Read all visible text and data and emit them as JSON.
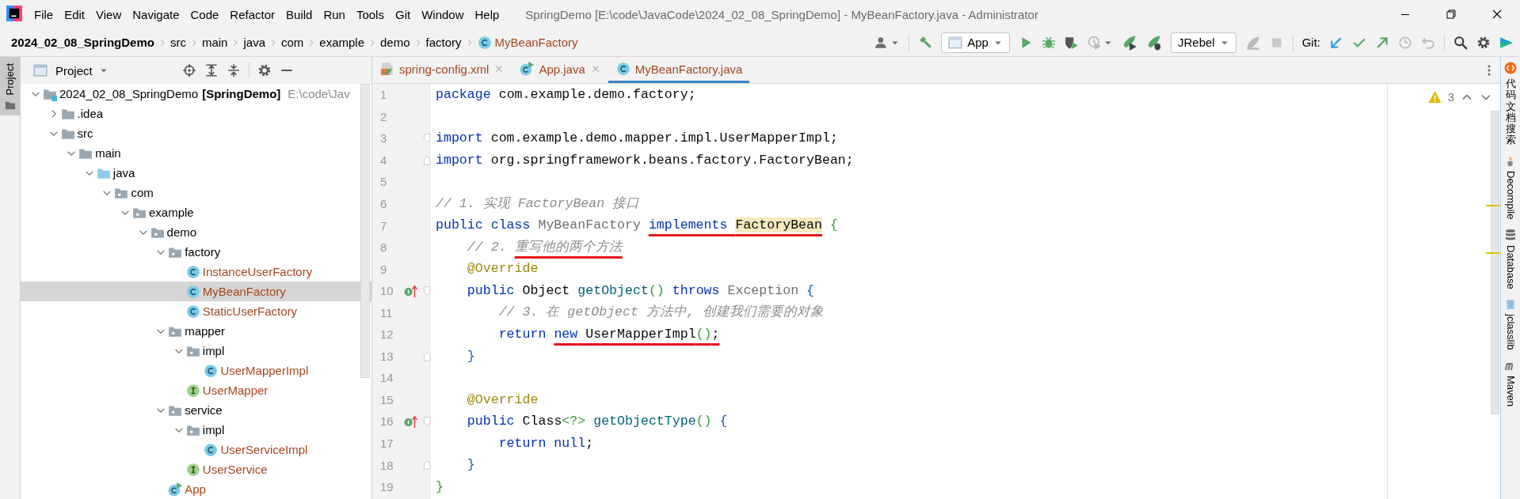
{
  "window": {
    "title": "SpringDemo [E:\\code\\JavaCode\\2024_02_08_SpringDemo] - MyBeanFactory.java - Administrator"
  },
  "menu": [
    {
      "label": "File"
    },
    {
      "label": "Edit"
    },
    {
      "label": "View"
    },
    {
      "label": "Navigate"
    },
    {
      "label": "Code"
    },
    {
      "label": "Refactor"
    },
    {
      "label": "Build"
    },
    {
      "label": "Run"
    },
    {
      "label": "Tools"
    },
    {
      "label": "Git"
    },
    {
      "label": "Window"
    },
    {
      "label": "Help"
    }
  ],
  "breadcrumbs": [
    {
      "label": "2024_02_08_SpringDemo",
      "kind": "project"
    },
    {
      "label": "src",
      "kind": "folder"
    },
    {
      "label": "main",
      "kind": "folder"
    },
    {
      "label": "java",
      "kind": "folder"
    },
    {
      "label": "com",
      "kind": "folder"
    },
    {
      "label": "example",
      "kind": "folder"
    },
    {
      "label": "demo",
      "kind": "folder"
    },
    {
      "label": "factory",
      "kind": "folder"
    },
    {
      "label": "MyBeanFactory",
      "kind": "class"
    }
  ],
  "toolbar": {
    "run_config": "App",
    "jrebel_config": "JRebel",
    "git_label": "Git:"
  },
  "left_stripe": [
    {
      "label": "Project",
      "selected": true
    }
  ],
  "project": {
    "title": "Project",
    "tree": [
      {
        "label": "2024_02_08_SpringDemo",
        "module": "[SpringDemo]",
        "path": "E:\\code\\Jav",
        "kind": "module",
        "expanded": true,
        "selected": false,
        "children": [
          {
            "label": ".idea",
            "kind": "folder",
            "expanded": false,
            "selected": false
          },
          {
            "label": "src",
            "kind": "folder",
            "expanded": true,
            "selected": false,
            "children": [
              {
                "label": "main",
                "kind": "folder",
                "expanded": true,
                "selected": false,
                "children": [
                  {
                    "label": "java",
                    "kind": "source",
                    "expanded": true,
                    "selected": false,
                    "children": [
                      {
                        "label": "com",
                        "kind": "package",
                        "expanded": true,
                        "selected": false,
                        "children": [
                          {
                            "label": "example",
                            "kind": "package",
                            "expanded": true,
                            "selected": false,
                            "children": [
                              {
                                "label": "demo",
                                "kind": "package",
                                "expanded": true,
                                "selected": false,
                                "children": [
                                  {
                                    "label": "factory",
                                    "kind": "package",
                                    "expanded": true,
                                    "selected": false,
                                    "children": [
                                      {
                                        "label": "InstanceUserFactory",
                                        "kind": "class",
                                        "selected": false
                                      },
                                      {
                                        "label": "MyBeanFactory",
                                        "kind": "class",
                                        "selected": true
                                      },
                                      {
                                        "label": "StaticUserFactory",
                                        "kind": "class",
                                        "selected": false
                                      }
                                    ]
                                  },
                                  {
                                    "label": "mapper",
                                    "kind": "package",
                                    "expanded": true,
                                    "selected": false,
                                    "children": [
                                      {
                                        "label": "impl",
                                        "kind": "package",
                                        "expanded": true,
                                        "selected": false,
                                        "children": [
                                          {
                                            "label": "UserMapperImpl",
                                            "kind": "class",
                                            "selected": false
                                          }
                                        ]
                                      },
                                      {
                                        "label": "UserMapper",
                                        "kind": "interface",
                                        "selected": false
                                      }
                                    ]
                                  },
                                  {
                                    "label": "service",
                                    "kind": "package",
                                    "expanded": true,
                                    "selected": false,
                                    "children": [
                                      {
                                        "label": "impl",
                                        "kind": "package",
                                        "expanded": true,
                                        "selected": false,
                                        "children": [
                                          {
                                            "label": "UserServiceImpl",
                                            "kind": "class",
                                            "selected": false
                                          }
                                        ]
                                      },
                                      {
                                        "label": "UserService",
                                        "kind": "interface",
                                        "selected": false
                                      }
                                    ]
                                  },
                                  {
                                    "label": "App",
                                    "kind": "app",
                                    "selected": false
                                  }
                                ]
                              }
                            ]
                          }
                        ]
                      }
                    ]
                  }
                ]
              }
            ]
          }
        ]
      }
    ]
  },
  "tabs": [
    {
      "label": "spring-config.xml",
      "kind": "xml",
      "selected": false
    },
    {
      "label": "App.java",
      "kind": "app",
      "selected": false
    },
    {
      "label": "MyBeanFactory.java",
      "kind": "class",
      "selected": true
    }
  ],
  "editor": {
    "warnings": "3",
    "lines": [
      {
        "number": "1",
        "tokens": [
          {
            "kind": "kw",
            "text": "package"
          },
          {
            "kind": "plain",
            "text": " com.example.demo.factory;"
          }
        ]
      },
      {
        "number": "2"
      },
      {
        "number": "3",
        "fold_start": true,
        "tokens": [
          {
            "kind": "kw",
            "text": "import"
          },
          {
            "kind": "plain",
            "text": " com.example.demo.mapper.impl.UserMapperImpl;"
          }
        ]
      },
      {
        "number": "4",
        "fold_end": true,
        "tokens": [
          {
            "kind": "kw",
            "text": "import"
          },
          {
            "kind": "plain",
            "text": " org.springframework.beans.factory.FactoryBean;"
          }
        ]
      },
      {
        "number": "5"
      },
      {
        "number": "6",
        "tokens": [
          {
            "kind": "comment",
            "text": "// 1. 实现 FactoryBean 接口"
          }
        ]
      },
      {
        "number": "7",
        "tokens": [
          {
            "kind": "kw",
            "text": "public class"
          },
          {
            "kind": "dim",
            "text": " MyBeanFactory "
          },
          {
            "kind": "kw",
            "text": "implements ",
            "underlined": true
          },
          {
            "kind": "plain",
            "text": "FactoryBean",
            "underlined": true,
            "highlighted": true
          },
          {
            "kind": "green",
            "text": " {"
          }
        ]
      },
      {
        "number": "8",
        "tokens": [
          {
            "kind": "comment",
            "text": "    // 2. "
          },
          {
            "kind": "comment",
            "text": "重写他的两个方法",
            "underlined": true
          }
        ]
      },
      {
        "number": "9",
        "tokens": [
          {
            "kind": "anno",
            "text": "    @Override"
          }
        ]
      },
      {
        "number": "10",
        "implements_marker": true,
        "fold_start": true,
        "tokens": [
          {
            "kind": "kw",
            "text": "    public"
          },
          {
            "kind": "plain",
            "text": " Object "
          },
          {
            "kind": "fn",
            "text": "getObject"
          },
          {
            "kind": "green",
            "text": "()"
          },
          {
            "kind": "kw",
            "text": " throws"
          },
          {
            "kind": "dim",
            "text": " Exception "
          },
          {
            "kind": "blue",
            "text": "{"
          }
        ]
      },
      {
        "number": "11",
        "tokens": [
          {
            "kind": "comment",
            "text": "        // 3. 在 getObject 方法中, 创建我们需要的对象"
          }
        ]
      },
      {
        "number": "12",
        "tokens": [
          {
            "kind": "kw",
            "text": "        return "
          },
          {
            "kind": "kw",
            "text": "new",
            "underlined": true
          },
          {
            "kind": "plain",
            "text": " UserMapperImpl",
            "underlined": true
          },
          {
            "kind": "green",
            "text": "()",
            "underlined": true
          },
          {
            "kind": "plain",
            "text": ";",
            "underlined": true
          }
        ]
      },
      {
        "number": "13",
        "fold_end": true,
        "tokens": [
          {
            "kind": "blue",
            "text": "    }"
          }
        ]
      },
      {
        "number": "14"
      },
      {
        "number": "15",
        "tokens": [
          {
            "kind": "anno",
            "text": "    @Override"
          }
        ]
      },
      {
        "number": "16",
        "implements_marker": true,
        "fold_start": true,
        "tokens": [
          {
            "kind": "kw",
            "text": "    public"
          },
          {
            "kind": "plain",
            "text": " Class"
          },
          {
            "kind": "green",
            "text": "<?>"
          },
          {
            "kind": "fn",
            "text": " getObjectType"
          },
          {
            "kind": "green",
            "text": "()"
          },
          {
            "kind": "blue",
            "text": " {"
          }
        ]
      },
      {
        "number": "17",
        "tokens": [
          {
            "kind": "kw",
            "text": "        return null"
          },
          {
            "kind": "plain",
            "text": ";"
          }
        ]
      },
      {
        "number": "18",
        "fold_end": true,
        "tokens": [
          {
            "kind": "blue",
            "text": "    }"
          }
        ]
      },
      {
        "number": "19",
        "tokens": [
          {
            "kind": "green",
            "text": "}"
          }
        ]
      }
    ]
  },
  "right_stripe": [
    {
      "label": "代码文档搜索",
      "kind": "cjk"
    },
    {
      "label": "Decompile",
      "kind": "decompile"
    },
    {
      "label": "Database",
      "kind": "database"
    },
    {
      "label": "jclasslib",
      "kind": "jclasslib"
    },
    {
      "label": "Maven",
      "kind": "maven"
    }
  ]
}
